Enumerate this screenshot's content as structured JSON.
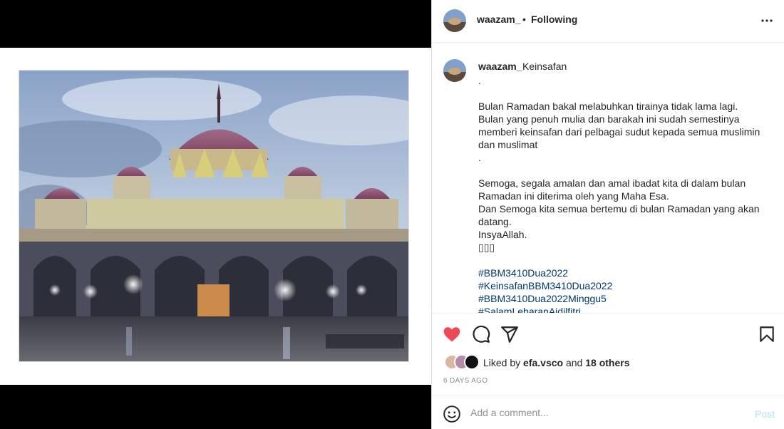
{
  "post": {
    "username": "waazam_",
    "follow_dot": "•",
    "follow_status": "Following",
    "caption_title": "Keinsafan",
    "caption_lines": [
      ".",
      "",
      "Bulan Ramadan bakal melabuhkan tirainya tidak lama lagi.",
      "Bulan yang penuh mulia dan barakah ini sudah semestinya",
      "memberi keinsafan dari pelbagai sudut kepada semua muslimin",
      "dan muslimat",
      ".",
      "",
      "Semoga, segala amalan dan amal ibadat kita di dalam bulan",
      "Ramadan ini diterima oleh yang Maha Esa.",
      "Dan Semoga kita semua bertemu di bulan Ramadan yang akan",
      "datang.",
      "InsyaAllah.",
      "▯▯▯",
      ""
    ],
    "hashtags": [
      "#BBM3410Dua2022",
      "#KeinsafanBBM3410Dua2022",
      "#BBM3410Dua2022Minggu5",
      "#SalamLebaranAidilfitri"
    ],
    "liked_by_prefix": "Liked by",
    "liked_by_user": "efa.vsco",
    "liked_by_and": "and",
    "liked_by_others": "18 others",
    "date": "6 DAYS AGO",
    "liked": true
  },
  "comment": {
    "placeholder": "Add a comment...",
    "post_label": "Post"
  },
  "colors": {
    "heart": "#ed4956",
    "post_disabled": "#b2dffc",
    "hashtag": "#00376b"
  },
  "icons": [
    "more-icon",
    "heart-icon",
    "comment-icon",
    "share-icon",
    "save-icon",
    "emoji-icon"
  ]
}
